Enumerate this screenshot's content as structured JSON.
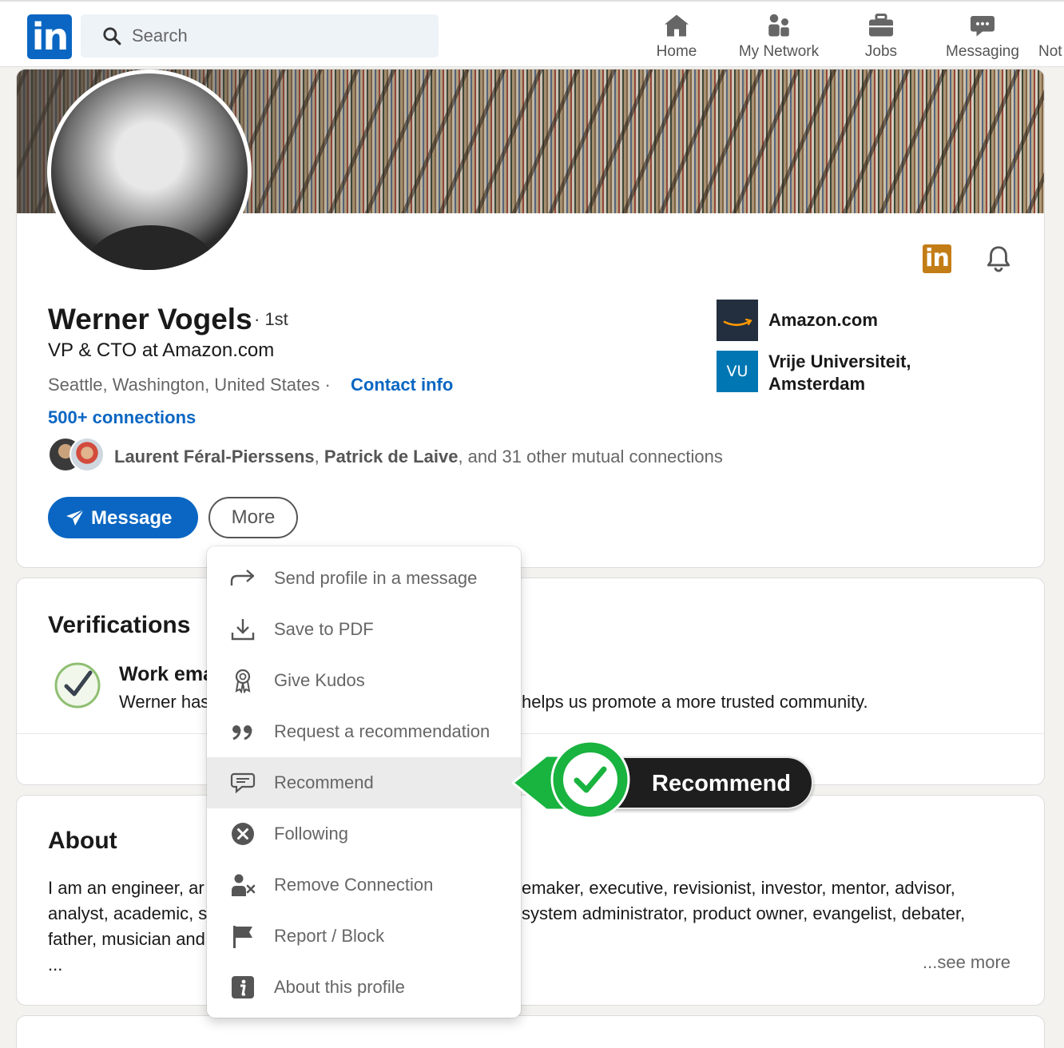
{
  "nav": {
    "logo_text": "in",
    "search_placeholder": "Search",
    "items": [
      {
        "label": "Home",
        "icon": "home-icon"
      },
      {
        "label": "My Network",
        "icon": "network-icon"
      },
      {
        "label": "Jobs",
        "icon": "briefcase-icon"
      },
      {
        "label": "Messaging",
        "icon": "messaging-icon"
      },
      {
        "label": "Not",
        "icon": "bell-icon"
      }
    ]
  },
  "profile": {
    "name": "Werner Vogels",
    "degree": "· 1st",
    "headline": "VP & CTO at Amazon.com",
    "location": "Seattle, Washington, United States ·",
    "contact_info": "Contact info",
    "connections": "500+ connections",
    "mutual_name_1": "Laurent Féral-Pierssens",
    "mutual_sep": ", ",
    "mutual_name_2": "Patrick de Laive",
    "mutual_rest": ", and 31 other mutual connections",
    "companies": [
      {
        "name": "Amazon.com",
        "logo": "amazon-logo"
      },
      {
        "name_line1": "Vrije Universiteit,",
        "name_line2": "Amsterdam",
        "logo_text": "VU"
      }
    ],
    "premium_badge": "in",
    "actions": {
      "message": "Message",
      "more": "More"
    }
  },
  "verifications": {
    "title": "Verifications",
    "item_title_visible": "Work ema",
    "item_desc_left": "Werner has",
    "item_desc_right": "helps us promote a more trusted community."
  },
  "about": {
    "title": "About",
    "lines_left": [
      "I am an engineer, ar",
      "analyst, academic, s",
      "father, musician and",
      "..."
    ],
    "lines_right": [
      "emaker, executive, revisionist, investor, mentor, advisor,",
      "system administrator, product owner, evangelist, debater,"
    ],
    "see_more": "...see more"
  },
  "more_menu": {
    "items": [
      {
        "label": "Send profile in a message",
        "icon": "share-arrow-icon"
      },
      {
        "label": "Save to PDF",
        "icon": "download-icon"
      },
      {
        "label": "Give Kudos",
        "icon": "award-icon"
      },
      {
        "label": "Request a recommendation",
        "icon": "quote-icon"
      },
      {
        "label": "Recommend",
        "icon": "speech-bubble-icon",
        "highlighted": true
      },
      {
        "label": "Following",
        "icon": "x-circle-icon"
      },
      {
        "label": "Remove Connection",
        "icon": "remove-person-icon"
      },
      {
        "label": "Report / Block",
        "icon": "flag-icon"
      },
      {
        "label": "About this profile",
        "icon": "info-icon"
      }
    ]
  },
  "callout": {
    "label": "Recommend",
    "accent": "#19b33f"
  },
  "colors": {
    "brand": "#0a66c2",
    "premium": "#c37d16",
    "text": "#191919",
    "muted": "#666666"
  }
}
